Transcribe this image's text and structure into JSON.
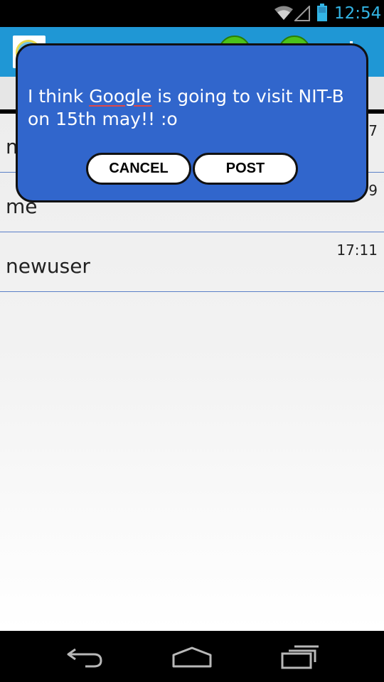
{
  "status_bar": {
    "time": "12:54",
    "icons": [
      "wifi-icon",
      "signal-icon",
      "battery-icon"
    ],
    "accent_color": "#33b5e5"
  },
  "action_bar": {
    "background_color": "#1f97d5",
    "icons": [
      "app-logo-icon",
      "action-button-green",
      "action-button-green",
      "overflow-menu-icon"
    ]
  },
  "chat_list": {
    "items": [
      {
        "name": "m",
        "time": "7"
      },
      {
        "name": "me",
        "time": "9"
      },
      {
        "name": "newuser",
        "time": "17:11"
      }
    ],
    "divider_color": "#5a7fc7"
  },
  "dialog": {
    "message_before": "I think ",
    "message_misspelled": "Google",
    "message_after": " is going to visit NIT-B on 15th may!! :o",
    "cancel_label": "CANCEL",
    "post_label": "POST",
    "background_color": "#3166cc"
  },
  "nav_bar": {
    "icons": [
      "back-icon",
      "home-icon",
      "recent-apps-icon"
    ]
  }
}
